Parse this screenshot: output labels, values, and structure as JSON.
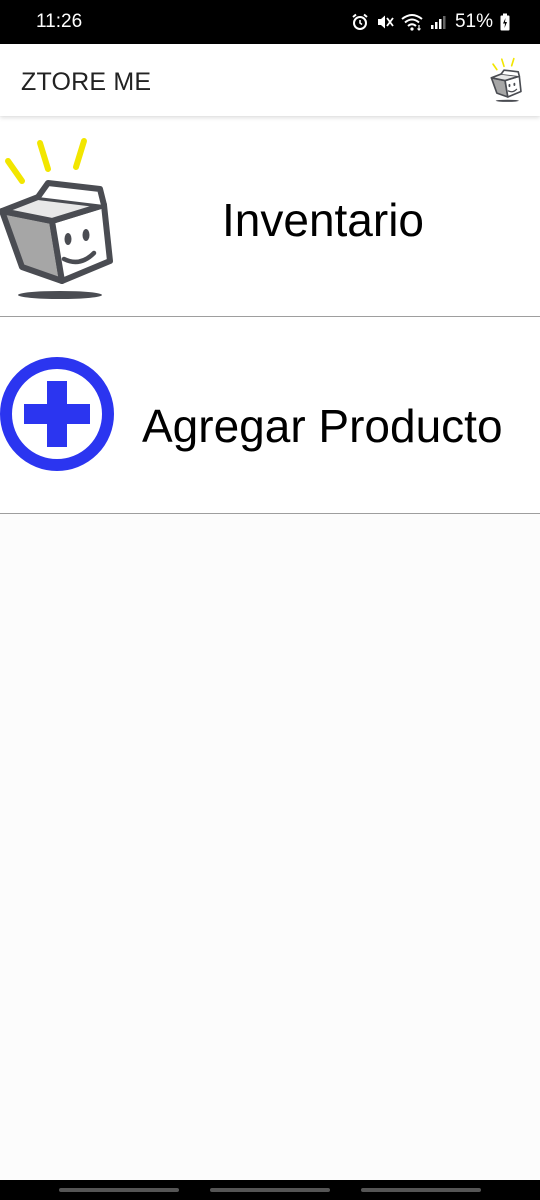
{
  "status_bar": {
    "time": "11:26",
    "battery_percent": "51%",
    "icons": [
      "alarm-icon",
      "mute-icon",
      "wifi-icon",
      "signal-icon",
      "battery-icon"
    ]
  },
  "app_bar": {
    "title": "ZTORE ME",
    "logo_icon": "ztore-box-logo-icon"
  },
  "menu": {
    "items": [
      {
        "label": "Inventario",
        "icon": "open-box-icon"
      },
      {
        "label": "Agregar Producto",
        "icon": "plus-circle-icon"
      }
    ]
  },
  "colors": {
    "status_bar_bg": "#000000",
    "app_bar_bg": "#ffffff",
    "background": "#fcfcfc",
    "add_icon_blue": "#2b35f0",
    "box_yellow_rays": "#f2e600",
    "box_gray": "#a6a6a6",
    "box_outline": "#4a4c52",
    "divider": "#9e9e9e"
  },
  "nav_bar": {
    "buttons": [
      "recent-apps-button",
      "home-button",
      "back-button"
    ]
  }
}
